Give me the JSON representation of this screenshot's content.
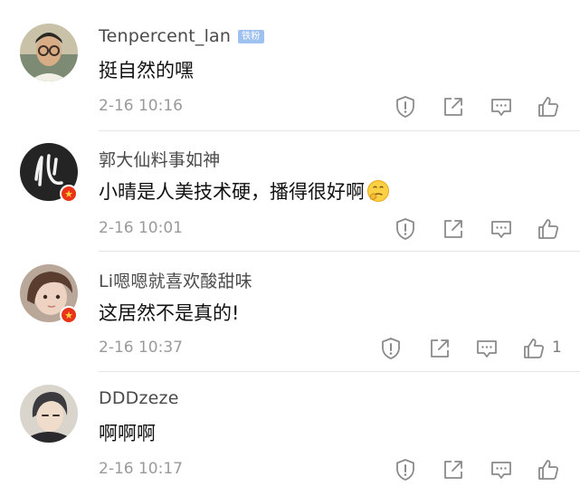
{
  "comments": [
    {
      "username": "Tenpercent_lan",
      "badge": "铁粉",
      "text": "挺自然的嘿",
      "time": "2-16 10:16",
      "avatar": "photo-avatar-man",
      "verified": false,
      "likes": ""
    },
    {
      "username": "郭大仙料事如神",
      "text": "小晴是人美技术硬，播得很好啊",
      "emoji": "thinking-face-icon",
      "time": "2-16 10:01",
      "avatar": "calligraphy-avatar",
      "verified": true,
      "likes": ""
    },
    {
      "username": "Li嗯嗯就喜欢酸甜味",
      "text": "这居然不是真的!",
      "time": "2-16 10:37",
      "avatar": "photo-avatar-girl",
      "verified": true,
      "likes": "1"
    },
    {
      "username": "DDDzeze",
      "text": "啊啊啊",
      "time": "2-16 10:17",
      "avatar": "anime-avatar",
      "verified": false,
      "likes": ""
    }
  ],
  "colors": {
    "username": "#4a4a4a",
    "text": "#111111",
    "time": "#9a9a9a",
    "icon": "#8a8a8a",
    "badge": "#9fc1f0",
    "verified": "#e8331a"
  }
}
